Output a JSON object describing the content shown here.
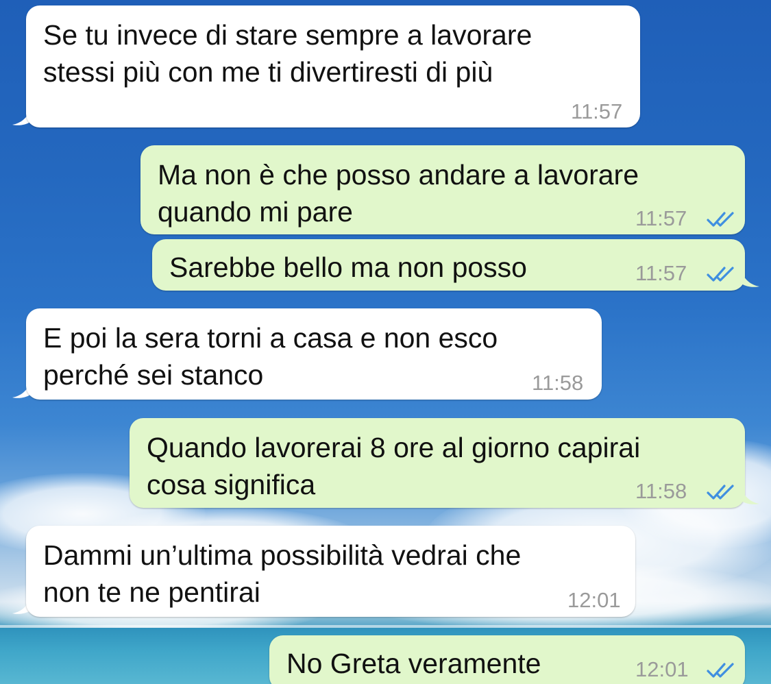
{
  "conversation": {
    "messages": [
      {
        "direction": "incoming",
        "text": "Se tu invece di stare sempre a lavorare\nstessi più con me ti divertiresti di più",
        "time": "11:57"
      },
      {
        "direction": "outgoing",
        "text": "Ma non è che posso andare a lavorare\nquando mi pare",
        "time": "11:57",
        "status": "read"
      },
      {
        "direction": "outgoing",
        "text": "Sarebbe bello ma non posso",
        "time": "11:57",
        "status": "read"
      },
      {
        "direction": "incoming",
        "text": "E poi la sera torni a casa e non esco\nperché sei stanco",
        "time": "11:58"
      },
      {
        "direction": "outgoing",
        "text": "Quando lavorerai 8 ore al giorno capirai\ncosa significa",
        "time": "11:58",
        "status": "read"
      },
      {
        "direction": "incoming",
        "text": "Dammi un’ultima possibilità vedrai che\nnon te ne pentirai",
        "time": "12:01"
      },
      {
        "direction": "outgoing",
        "text": "No Greta veramente",
        "time": "12:01",
        "status": "read"
      }
    ]
  },
  "colors": {
    "incoming_bubble": "#ffffff",
    "outgoing_bubble": "#e1f7cb",
    "read_ticks": "#3f8fe0",
    "timestamp": "#9a9a9a"
  },
  "icons": {
    "read_receipt": "double-check-icon"
  }
}
